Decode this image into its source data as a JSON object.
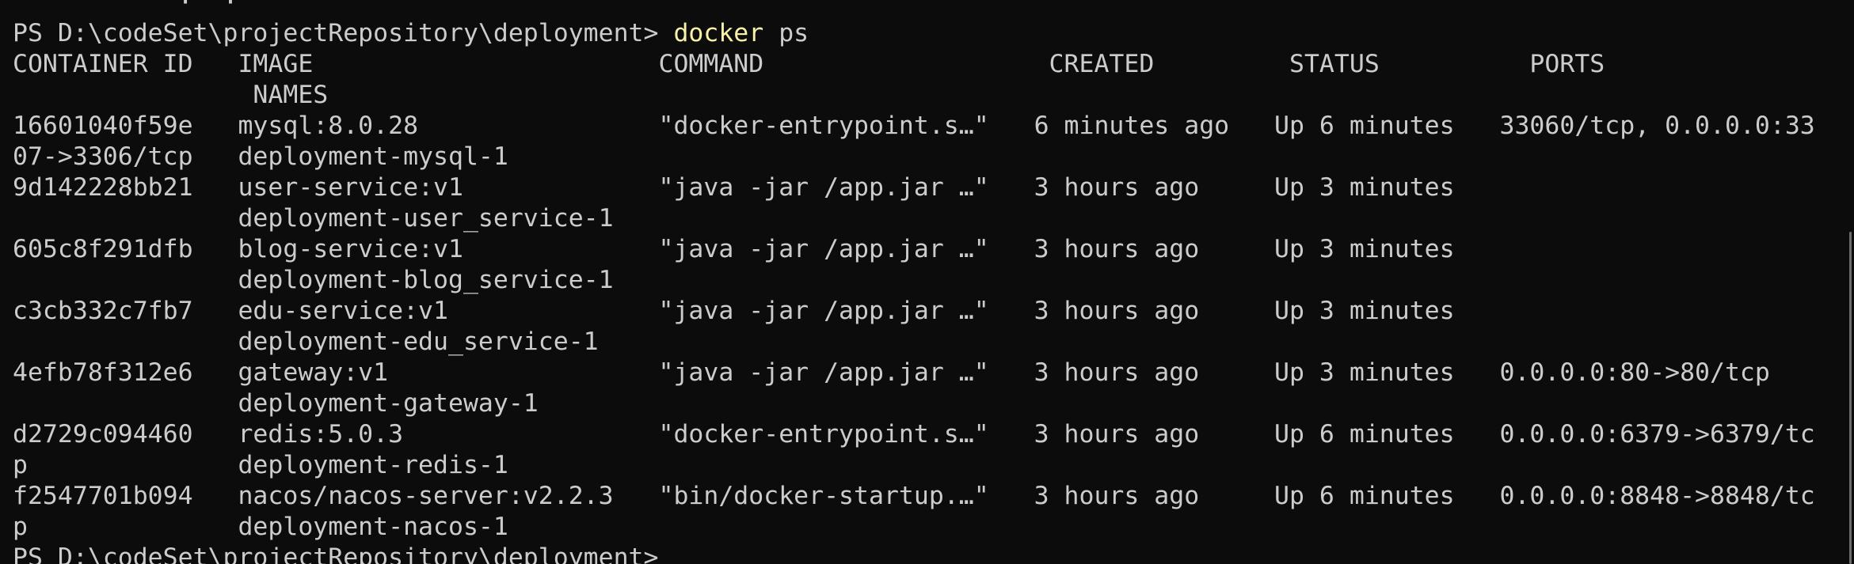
{
  "terminal": {
    "lines": [
      {
        "kind": "text",
        "text": "           ·  ·"
      },
      {
        "kind": "command",
        "prompt": "PS D:\\codeSet\\projectRepository\\deployment> ",
        "cmd": "docker",
        "args": " ps"
      },
      {
        "kind": "text",
        "text": "CONTAINER ID   IMAGE                       COMMAND                   CREATED         STATUS          PORTS"
      },
      {
        "kind": "text",
        "text": "                NAMES"
      },
      {
        "kind": "text",
        "text": "16601040f59e   mysql:8.0.28                \"docker-entrypoint.s…\"   6 minutes ago   Up 6 minutes   33060/tcp, 0.0.0.0:33"
      },
      {
        "kind": "text",
        "text": "07->3306/tcp   deployment-mysql-1"
      },
      {
        "kind": "text",
        "text": "9d142228bb21   user-service:v1             \"java -jar /app.jar …\"   3 hours ago     Up 3 minutes"
      },
      {
        "kind": "text",
        "text": "               deployment-user_service-1"
      },
      {
        "kind": "text",
        "text": "605c8f291dfb   blog-service:v1             \"java -jar /app.jar …\"   3 hours ago     Up 3 minutes"
      },
      {
        "kind": "text",
        "text": "               deployment-blog_service-1"
      },
      {
        "kind": "text",
        "text": "c3cb332c7fb7   edu-service:v1              \"java -jar /app.jar …\"   3 hours ago     Up 3 minutes"
      },
      {
        "kind": "text",
        "text": "               deployment-edu_service-1"
      },
      {
        "kind": "text",
        "text": "4efb78f312e6   gateway:v1                  \"java -jar /app.jar …\"   3 hours ago     Up 3 minutes   0.0.0.0:80->80/tcp"
      },
      {
        "kind": "text",
        "text": "               deployment-gateway-1"
      },
      {
        "kind": "text",
        "text": "d2729c094460   redis:5.0.3                 \"docker-entrypoint.s…\"   3 hours ago     Up 6 minutes   0.0.0.0:6379->6379/tc"
      },
      {
        "kind": "text",
        "text": "p              deployment-redis-1"
      },
      {
        "kind": "text",
        "text": "f2547701b094   nacos/nacos-server:v2.2.3   \"bin/docker-startup.…\"   3 hours ago     Up 6 minutes   0.0.0.0:8848->8848/tc"
      },
      {
        "kind": "text",
        "text": "p              deployment-nacos-1"
      },
      {
        "kind": "prompt",
        "prompt": "PS D:\\codeSet\\projectRepository\\deployment> "
      }
    ]
  },
  "colors": {
    "background": "#0c0c0c",
    "foreground": "#cccccc",
    "command_highlight": "#f9f1a5",
    "scrollbar_thumb": "#6e6e6e"
  }
}
